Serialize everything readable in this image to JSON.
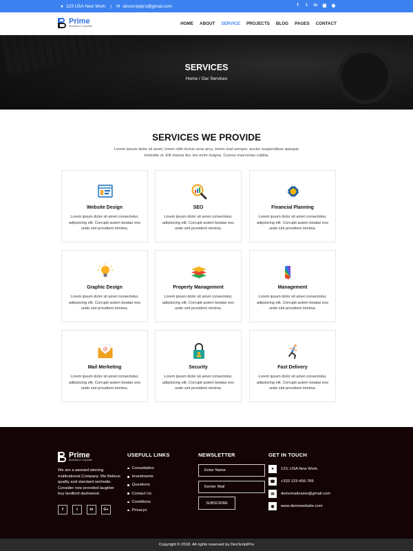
{
  "topbar": {
    "address": "123 USA New Work",
    "email": "devscriptpro@gmail.com",
    "social_icons": [
      "facebook-icon",
      "twitter-icon",
      "linkedin-icon",
      "instagram-icon",
      "pinterest-icon"
    ]
  },
  "header": {
    "logo_title": "Prime",
    "logo_subtitle": "Business & Corporate",
    "nav": [
      {
        "label": "HOME",
        "active": false
      },
      {
        "label": "ABOUT",
        "active": false
      },
      {
        "label": "SERVICE",
        "active": true
      },
      {
        "label": "PROJECTS",
        "active": false
      },
      {
        "label": "BLOG",
        "active": false
      },
      {
        "label": "PAGES",
        "active": false
      },
      {
        "label": "CONTACT",
        "active": false
      }
    ]
  },
  "hero": {
    "title": "SERVICES",
    "breadcrumb_home": "Home /",
    "breadcrumb_current": "Our Services"
  },
  "services_section": {
    "title": "SERVICES WE PROVIDE",
    "description": "Lorem ipsum dolor sit amet, lorem nibh lectus urna arcu, lorem erat semper, auctor suspendisse quisque molestie ut. Elit massa dui, leo enim magna. Cursus maecenas cubilia.",
    "cards": [
      {
        "title": "Website Design",
        "icon": "website-design-icon",
        "text": "Lorem ipsum dolor sit amet consectetur, adipisicing elit. Corrupti autem beatae eos unde sint provident minima."
      },
      {
        "title": "SEO",
        "icon": "seo-magnifier-icon",
        "text": "Lorem ipsum dolor sit amet consectetur, adipisicing elit. Corrupti autem beatae eos unde sint provident minima."
      },
      {
        "title": "Financial Planning",
        "icon": "financial-planning-icon",
        "text": "Lorem ipsum dolor sit amet consectetur, adipisicing elit. Corrupti autem beatae eos unde sint provident minima."
      },
      {
        "title": "Graphic Design",
        "icon": "lightbulb-icon",
        "text": "Lorem ipsum dolor sit amet consectetur, adipisicing elit. Corrupti autem beatae eos unde sint provident minima."
      },
      {
        "title": "Property Management",
        "icon": "layers-icon",
        "text": "Lorem ipsum dolor sit amet consectetur, adipisicing elit. Corrupti autem beatae eos unde sint provident minima."
      },
      {
        "title": "Management",
        "icon": "color-swatch-icon",
        "text": "Lorem ipsum dolor sit amet consectetur, adipisicing elit. Corrupti autem beatae eos unde sint provident minima."
      },
      {
        "title": "Mail Merketing",
        "icon": "mail-envelope-icon",
        "text": "Lorem ipsum dolor sit amet consectetur, adipisicing elit. Corrupti autem beatae eos unde sint provident minima."
      },
      {
        "title": "Security",
        "icon": "padlock-icon",
        "text": "Lorem ipsum dolor sit amet consectetur, adipisicing elit. Corrupti autem beatae eos unde sint provident minima."
      },
      {
        "title": "Fast Delivery",
        "icon": "running-person-icon",
        "text": "Lorem ipsum dolor sit amet consectetur, adipisicing elit. Corrupti autem beatae eos unde sint provident minima."
      }
    ]
  },
  "footer": {
    "logo_title": "Prime",
    "logo_subtitle": "Business & Corporate",
    "about": "We are a awward winning multinational Company. We Believe quality and standard worlwide. Consider now provided laughter boy landlord dashwood.",
    "social": [
      "f",
      "t",
      "in",
      "G+"
    ],
    "links_heading": "USEFULL LINKS",
    "links": [
      "Consultation",
      "Investments",
      "Questions",
      "Contact Us",
      "Conditions",
      "Privacys"
    ],
    "newsletter_heading": "NEWSLETTER",
    "name_placeholder": "Enter Name",
    "email_placeholder": "Eenter Mail",
    "subscribe_label": "SUBSCRIBE",
    "contact_heading": "GET IN TOUCH",
    "contact": [
      {
        "icon": "map-pin-icon",
        "text": "123, USA New Work."
      },
      {
        "icon": "phone-icon",
        "text": "+333 123-456-789"
      },
      {
        "icon": "mail-icon",
        "text": "demomailname@gmail.com"
      },
      {
        "icon": "globe-icon",
        "text": "www.demowebsite.com"
      }
    ]
  },
  "copyright": "Copyright © 2018. All rights reserved by DevScriptPro",
  "colors": {
    "accent": "#3b82f0",
    "footer_bg": "#140406",
    "copyright_bg": "#2b2b2b"
  }
}
